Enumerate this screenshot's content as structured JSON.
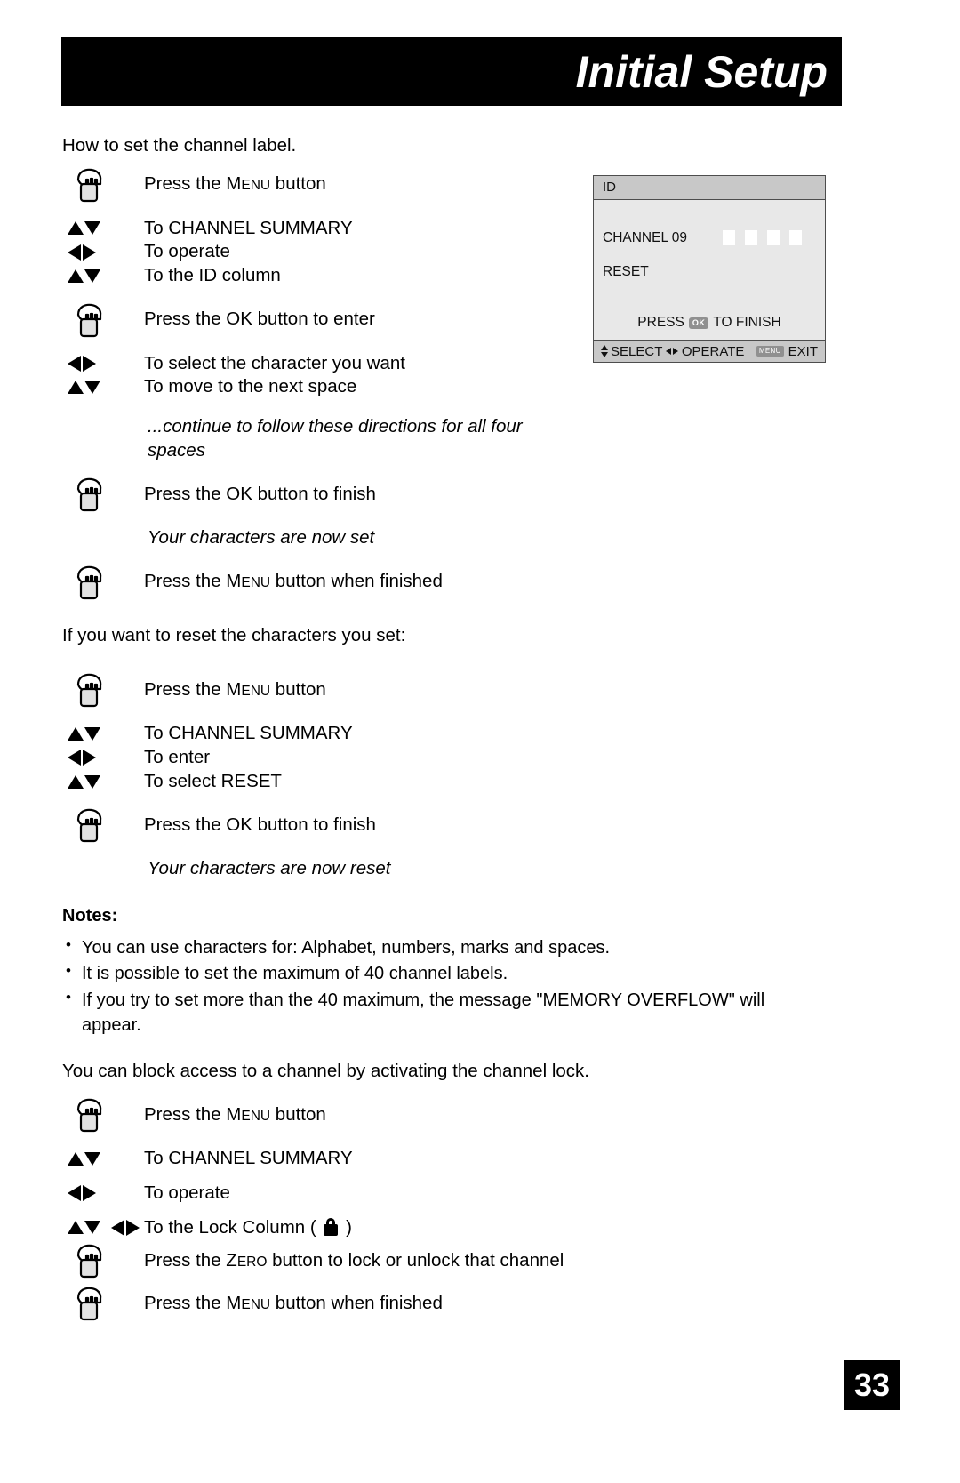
{
  "header": {
    "title": "Initial Setup"
  },
  "page_number": "33",
  "sections": {
    "intro_label": "How to set the channel label.",
    "reset_label": "If you want to reset the characters you set:",
    "lock_label": "You can block access to a channel by activating the channel lock."
  },
  "steps_set_label": [
    {
      "icon": "hand-press-icon",
      "text_pre": "Press the ",
      "key_big": "M",
      "key_small": "ENU",
      "text_post": " button"
    },
    {
      "icon": "up-down-arrow-icon",
      "text": "To CHANNEL SUMMARY"
    },
    {
      "icon": "left-right-arrow-icon",
      "text": "To operate"
    },
    {
      "icon": "up-down-arrow-icon",
      "text": "To the ID column"
    },
    {
      "icon": "hand-press-icon",
      "text": "Press the OK button to enter"
    },
    {
      "icon": "left-right-arrow-icon",
      "text": "To select the character you want"
    },
    {
      "icon": "up-down-arrow-icon",
      "text": "To move to the next space"
    }
  ],
  "notes_inline": {
    "continue_note": "...continue to follow these directions for all four spaces",
    "characters_set": "Your characters are now set",
    "characters_reset": "Your characters are now reset"
  },
  "steps_finish": [
    {
      "icon": "hand-press-icon",
      "text": "Press the OK button to finish"
    },
    {
      "icon": "hand-press-icon",
      "text_pre": "Press the ",
      "key_big": "M",
      "key_small": "ENU",
      "text_post": " button when finished"
    }
  ],
  "steps_reset": [
    {
      "icon": "hand-press-icon",
      "text_pre": "Press the ",
      "key_big": "M",
      "key_small": "ENU",
      "text_post": " button"
    },
    {
      "icon": "up-down-arrow-icon",
      "text": "To CHANNEL SUMMARY"
    },
    {
      "icon": "left-right-arrow-icon",
      "text": "To enter"
    },
    {
      "icon": "up-down-arrow-icon",
      "text": "To select RESET"
    },
    {
      "icon": "hand-press-icon",
      "text": "Press the OK button to finish"
    }
  ],
  "notes": {
    "title": "Notes:",
    "items": [
      "You can use characters for: Alphabet, numbers, marks and spaces.",
      "It is possible to set the maximum of 40 channel labels.",
      "If you try to set more than the 40 maximum, the message \"MEMORY OVERFLOW\" will appear."
    ]
  },
  "steps_lock": {
    "menu_pre": "Press the ",
    "menu_big": "M",
    "menu_small": "ENU",
    "menu_post": " button",
    "channel_summary": "To CHANNEL SUMMARY",
    "operate": "To operate",
    "lock_column_pre": "To the Lock Column ( ",
    "lock_column_post": " )",
    "zero_pre": "Press the ",
    "zero_big": "Z",
    "zero_small": "ERO",
    "zero_post": " button to lock or unlock that channel",
    "menu_finish_pre": "Press the ",
    "menu_finish_big": "M",
    "menu_finish_small": "ENU",
    "menu_finish_post": " button when finished"
  },
  "osd": {
    "title": "ID",
    "channel": "CHANNEL 09",
    "reset": "RESET",
    "char_boxes": [
      "",
      "",
      "",
      ""
    ],
    "press_pre": "PRESS",
    "press_key": "OK",
    "press_post": "TO FINISH",
    "footer_select": "SELECT",
    "footer_operate": "OPERATE",
    "footer_menu_key": "MENU",
    "footer_exit": "EXIT"
  },
  "colors": {
    "header_bg": "#000000",
    "header_text": "#ffffff",
    "osd_title_bg": "#c8c8c8",
    "osd_body_bg": "#e8e8e8",
    "osd_border": "#4d4d4d",
    "key_bg": "#909090"
  }
}
